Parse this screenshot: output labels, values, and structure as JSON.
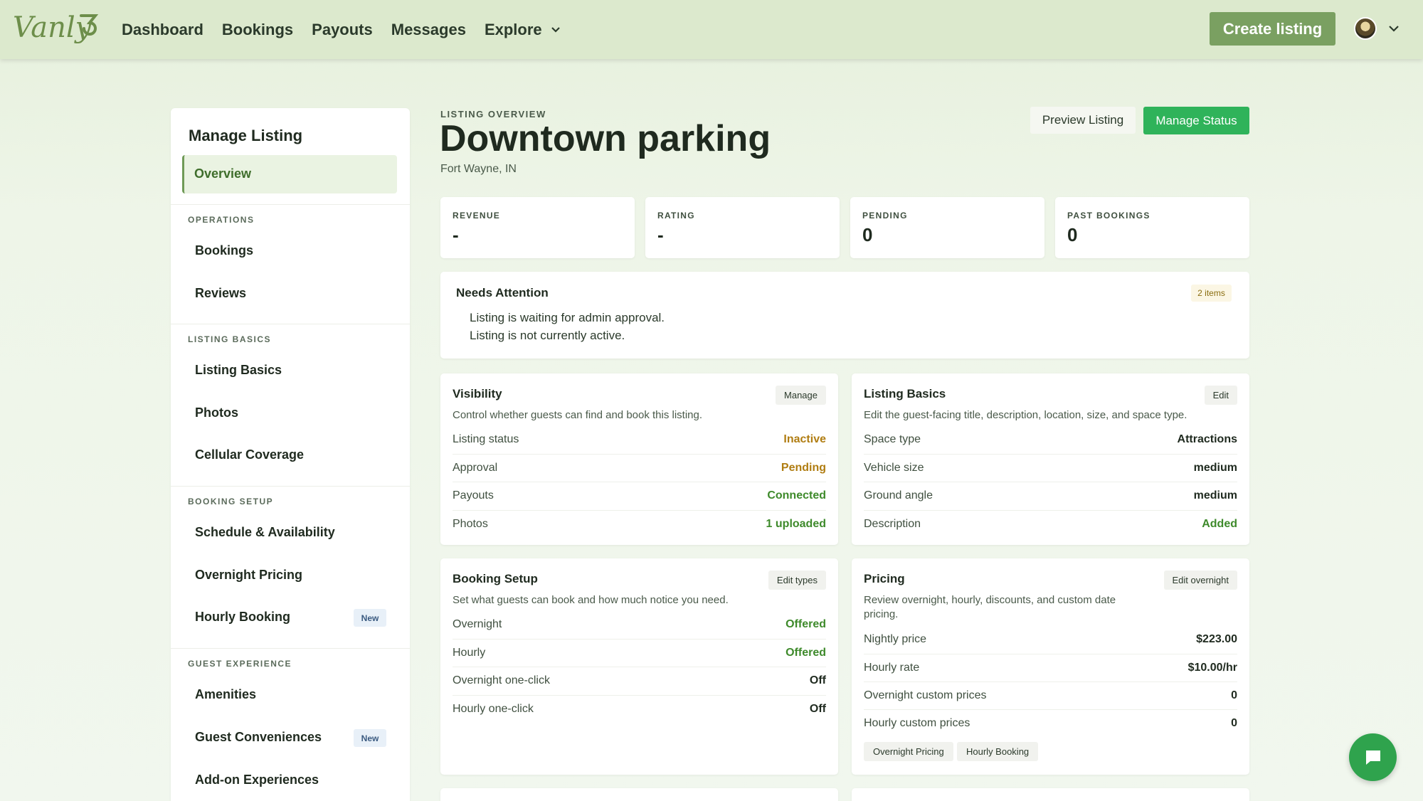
{
  "brand": {
    "logo_text": "Vanly",
    "accent": "#7aa061",
    "status_green": "#2fb35a"
  },
  "nav": {
    "items": [
      "Dashboard",
      "Bookings",
      "Payouts",
      "Messages",
      "Explore"
    ],
    "create_label": "Create listing"
  },
  "sidebar": {
    "title": "Manage Listing",
    "active": "Overview",
    "sections": [
      {
        "label": "OPERATIONS",
        "items": [
          "Bookings",
          "Reviews"
        ]
      },
      {
        "label": "LISTING BASICS",
        "items": [
          "Listing Basics",
          "Photos",
          "Cellular Coverage"
        ]
      },
      {
        "label": "BOOKING SETUP",
        "items": [
          "Schedule & Availability",
          "Overnight Pricing",
          "Hourly Booking"
        ]
      },
      {
        "label": "GUEST EXPERIENCE",
        "items": [
          "Amenities",
          "Guest Conveniences",
          "Add-on Experiences"
        ]
      }
    ],
    "new_badge": "New"
  },
  "header": {
    "eyebrow": "LISTING OVERVIEW",
    "title": "Downtown parking",
    "location": "Fort Wayne, IN",
    "preview_label": "Preview Listing",
    "status_label": "Manage Status"
  },
  "stats": [
    {
      "label": "REVENUE",
      "value": "-"
    },
    {
      "label": "RATING",
      "value": "-"
    },
    {
      "label": "PENDING",
      "value": "0"
    },
    {
      "label": "PAST BOOKINGS",
      "value": "0"
    }
  ],
  "attention": {
    "title": "Needs Attention",
    "badge": "2 items",
    "items": [
      "Listing is waiting for admin approval.",
      "Listing is not currently active."
    ]
  },
  "cards": {
    "visibility": {
      "title": "Visibility",
      "button": "Manage",
      "desc": "Control whether guests can find and book this listing.",
      "rows": [
        {
          "k": "Listing status",
          "v": "Inactive"
        },
        {
          "k": "Approval",
          "v": "Pending"
        },
        {
          "k": "Payouts",
          "v": "Connected"
        },
        {
          "k": "Photos",
          "v": "1 uploaded"
        }
      ]
    },
    "basics": {
      "title": "Listing Basics",
      "button": "Edit",
      "desc": "Edit the guest-facing title, description, location, size, and space type.",
      "rows": [
        {
          "k": "Space type",
          "v": "Attractions"
        },
        {
          "k": "Vehicle size",
          "v": "medium"
        },
        {
          "k": "Ground angle",
          "v": "medium"
        },
        {
          "k": "Description",
          "v": "Added"
        }
      ]
    },
    "booking": {
      "title": "Booking Setup",
      "button": "Edit types",
      "desc": "Set what guests can book and how much notice you need.",
      "rows": [
        {
          "k": "Overnight",
          "v": "Offered"
        },
        {
          "k": "Hourly",
          "v": "Offered"
        },
        {
          "k": "Overnight one-click",
          "v": "Off"
        },
        {
          "k": "Hourly one-click",
          "v": "Off"
        }
      ]
    },
    "pricing": {
      "title": "Pricing",
      "button": "Edit overnight",
      "desc": "Review overnight, hourly, discounts, and custom date pricing.",
      "rows": [
        {
          "k": "Nightly price",
          "v": "$223.00"
        },
        {
          "k": "Hourly rate",
          "v": "$10.00/hr"
        },
        {
          "k": "Overnight custom prices",
          "v": "0"
        },
        {
          "k": "Hourly custom prices",
          "v": "0"
        }
      ],
      "chips": [
        "Overnight Pricing",
        "Hourly Booking"
      ]
    }
  },
  "icons": {
    "explore": "chevron-down-icon",
    "user": "chevron-down-icon",
    "chat": "chat-bubble-icon"
  }
}
